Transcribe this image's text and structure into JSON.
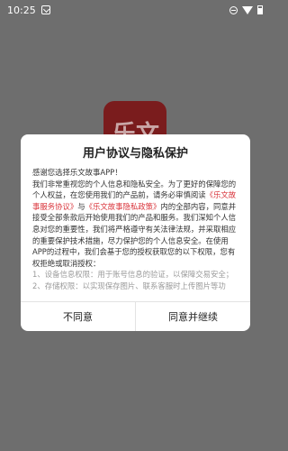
{
  "statusbar": {
    "time": "10:25"
  },
  "background": {
    "logo_text": "乐文"
  },
  "dialog": {
    "title": "用户协议与隐私保护",
    "greeting": "感谢您选择乐文故事APP！",
    "para1_a": "我们非常重视您的个人信息和隐私安全。为了更好的保障您的个人权益，在您使用我们的产品前，请务必审慎阅读",
    "link_service": "《乐文故事服务协议》",
    "and": "与",
    "link_privacy": "《乐文故事隐私政策》",
    "para1_b": "内的全部内容，同意并接受全部条款后开始使用我们的产品和服务。我们深知个人信息对您的重要性，我们将严格遵守有关法律法规，并采取相应的重要保护技术措施，尽力保护您的个人信息安全。在使用APP的过程中，我们会基于您的授权获取您的以下权限，您有权拒绝或取消授权：",
    "perm1": "1、设备信息权限：用于账号信息的验证，以保障交易安全；",
    "perm2": "2、存储权限：以实现保存图片、联系客服时上传图片等功能；",
    "btn_disagree": "不同意",
    "btn_agree": "同意并继续"
  },
  "colors": {
    "link": "#d9333a",
    "overlay": "#6e6e6e"
  }
}
